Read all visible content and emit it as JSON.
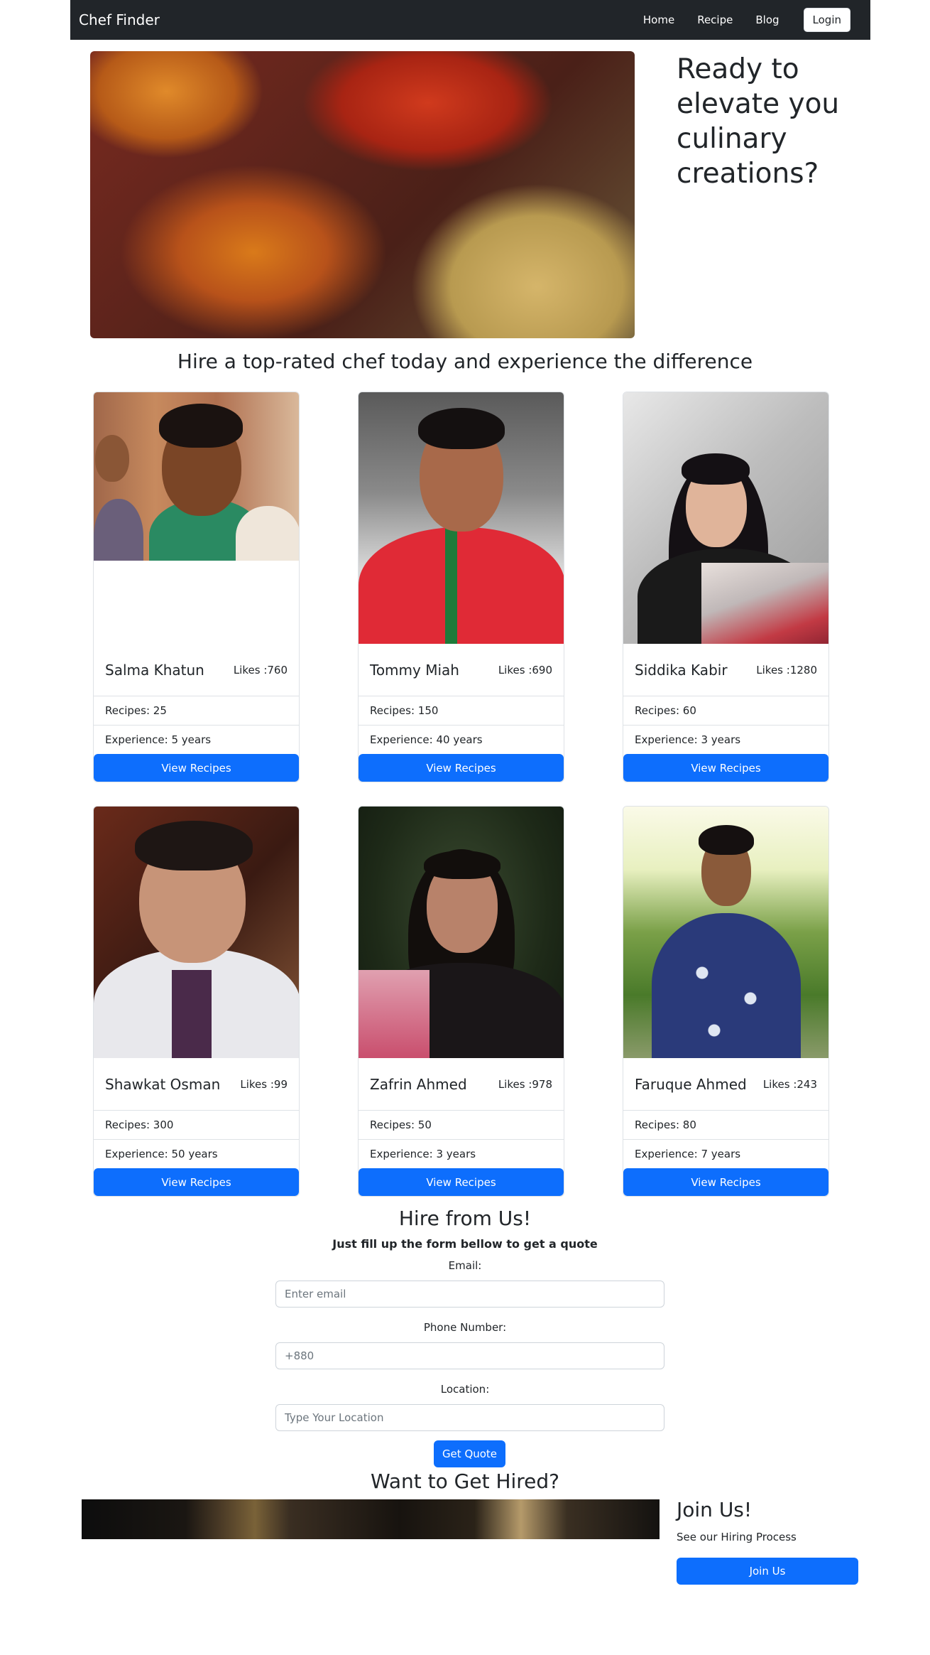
{
  "navbar": {
    "brand": "Chef Finder",
    "links": [
      "Home",
      "Recipe",
      "Blog"
    ],
    "login_label": "Login"
  },
  "hero": {
    "title": "Ready to elevate you culinary creations?"
  },
  "tagline": "Hire a top-rated chef today and experience the difference",
  "chefs": [
    {
      "name": "Salma Khatun",
      "likes": "Likes :760",
      "recipes": "Recipes: 25",
      "experience": "Experience: 5 years",
      "button": "View Recipes"
    },
    {
      "name": "Tommy Miah",
      "likes": "Likes :690",
      "recipes": "Recipes: 150",
      "experience": "Experience: 40 years",
      "button": "View Recipes"
    },
    {
      "name": "Siddika Kabir",
      "likes": "Likes :1280",
      "recipes": "Recipes: 60",
      "experience": "Experience: 3 years",
      "button": "View Recipes"
    },
    {
      "name": "Shawkat Osman",
      "likes": "Likes :99",
      "recipes": "Recipes: 300",
      "experience": "Experience: 50 years",
      "button": "View Recipes"
    },
    {
      "name": "Zafrin Ahmed",
      "likes": "Likes :978",
      "recipes": "Recipes: 50",
      "experience": "Experience: 3 years",
      "button": "View Recipes"
    },
    {
      "name": "Faruque Ahmed",
      "likes": "Likes :243",
      "recipes": "Recipes: 80",
      "experience": "Experience: 7 years",
      "button": "View Recipes"
    }
  ],
  "hire_form": {
    "title": "Hire from Us!",
    "subtitle": "Just fill up the form bellow to get a quote",
    "email_label": "Email:",
    "email_placeholder": "Enter email",
    "phone_label": "Phone Number:",
    "phone_placeholder": "+880",
    "location_label": "Location:",
    "location_placeholder": "Type Your Location",
    "submit_label": "Get Quote"
  },
  "get_hired": {
    "title": "Want to Get Hired?",
    "join_title": "Join Us!",
    "join_subtitle": "See our Hiring Process",
    "join_button": "Join Us"
  },
  "colors": {
    "navbar_bg": "#212529",
    "primary": "#0d6efd"
  }
}
